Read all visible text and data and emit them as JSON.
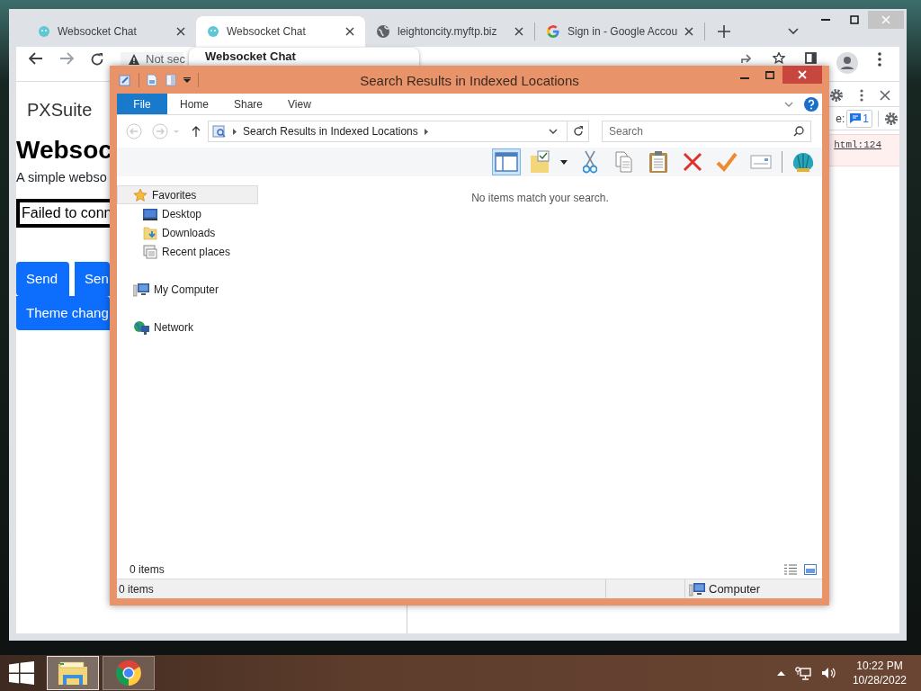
{
  "browser": {
    "tabs": [
      {
        "kind": "websocket",
        "title": "Websocket Chat",
        "selected": false
      },
      {
        "kind": "websocket",
        "title": "Websocket Chat",
        "selected": true
      },
      {
        "kind": "globe",
        "title": "leightoncity.myftp.biz",
        "selected": false
      },
      {
        "kind": "google",
        "title": "Sign in - Google Accou",
        "selected": false
      }
    ],
    "address": "Not sec",
    "tab_preview": "Websocket Chat",
    "page": {
      "brand": "PXSuite",
      "heading": "Websoc",
      "intro": "A simple webso",
      "status": "Failed to conn",
      "buttons": [
        {
          "label": "Send"
        },
        {
          "label": "Sen"
        },
        {
          "label": "Theme chang"
        }
      ]
    },
    "devtools": {
      "issues_label": "e:",
      "issues_count": "1",
      "source_link": "html:124"
    }
  },
  "explorer": {
    "title": "Search Results in Indexed Locations",
    "ribbon_tabs": [
      {
        "kind": "menu",
        "label": "File"
      },
      {
        "kind": "tab",
        "label": "Home"
      },
      {
        "kind": "tab",
        "label": "Share"
      },
      {
        "kind": "tab",
        "label": "View"
      }
    ],
    "path": "Search Results in Indexed Locations",
    "search": {
      "placeholder": "Search"
    },
    "toolbar": [
      {
        "kind": "preview-pane",
        "selected": true
      },
      {
        "kind": "folder-check",
        "selected": false
      },
      {
        "kind": "cut",
        "selected": false
      },
      {
        "kind": "copy",
        "selected": false
      },
      {
        "kind": "paste",
        "selected": false
      },
      {
        "kind": "delete",
        "selected": false
      },
      {
        "kind": "check",
        "selected": false
      },
      {
        "kind": "mail",
        "selected": false
      },
      {
        "kind": "shell",
        "selected": false
      }
    ],
    "nav": [
      {
        "kind": "favorites",
        "label": "Favorites",
        "selected": true,
        "children": [
          {
            "kind": "desktop",
            "label": "Desktop",
            "selected": false
          },
          {
            "kind": "downloads",
            "label": "Downloads",
            "selected": false
          },
          {
            "kind": "recent",
            "label": "Recent places",
            "selected": false
          }
        ]
      },
      {
        "kind": "computer",
        "label": "My Computer",
        "selected": false
      },
      {
        "kind": "network",
        "label": "Network",
        "selected": false
      }
    ],
    "empty_message": "No items match your search.",
    "item_count": "0 items",
    "status_bar": {
      "items": "0 items",
      "location": "Computer"
    }
  },
  "taskbar": {
    "apps": [
      {
        "kind": "explorer",
        "selected": true
      },
      {
        "kind": "chrome",
        "selected": false
      }
    ],
    "time": "10:22 PM",
    "date": "10/28/2022"
  }
}
